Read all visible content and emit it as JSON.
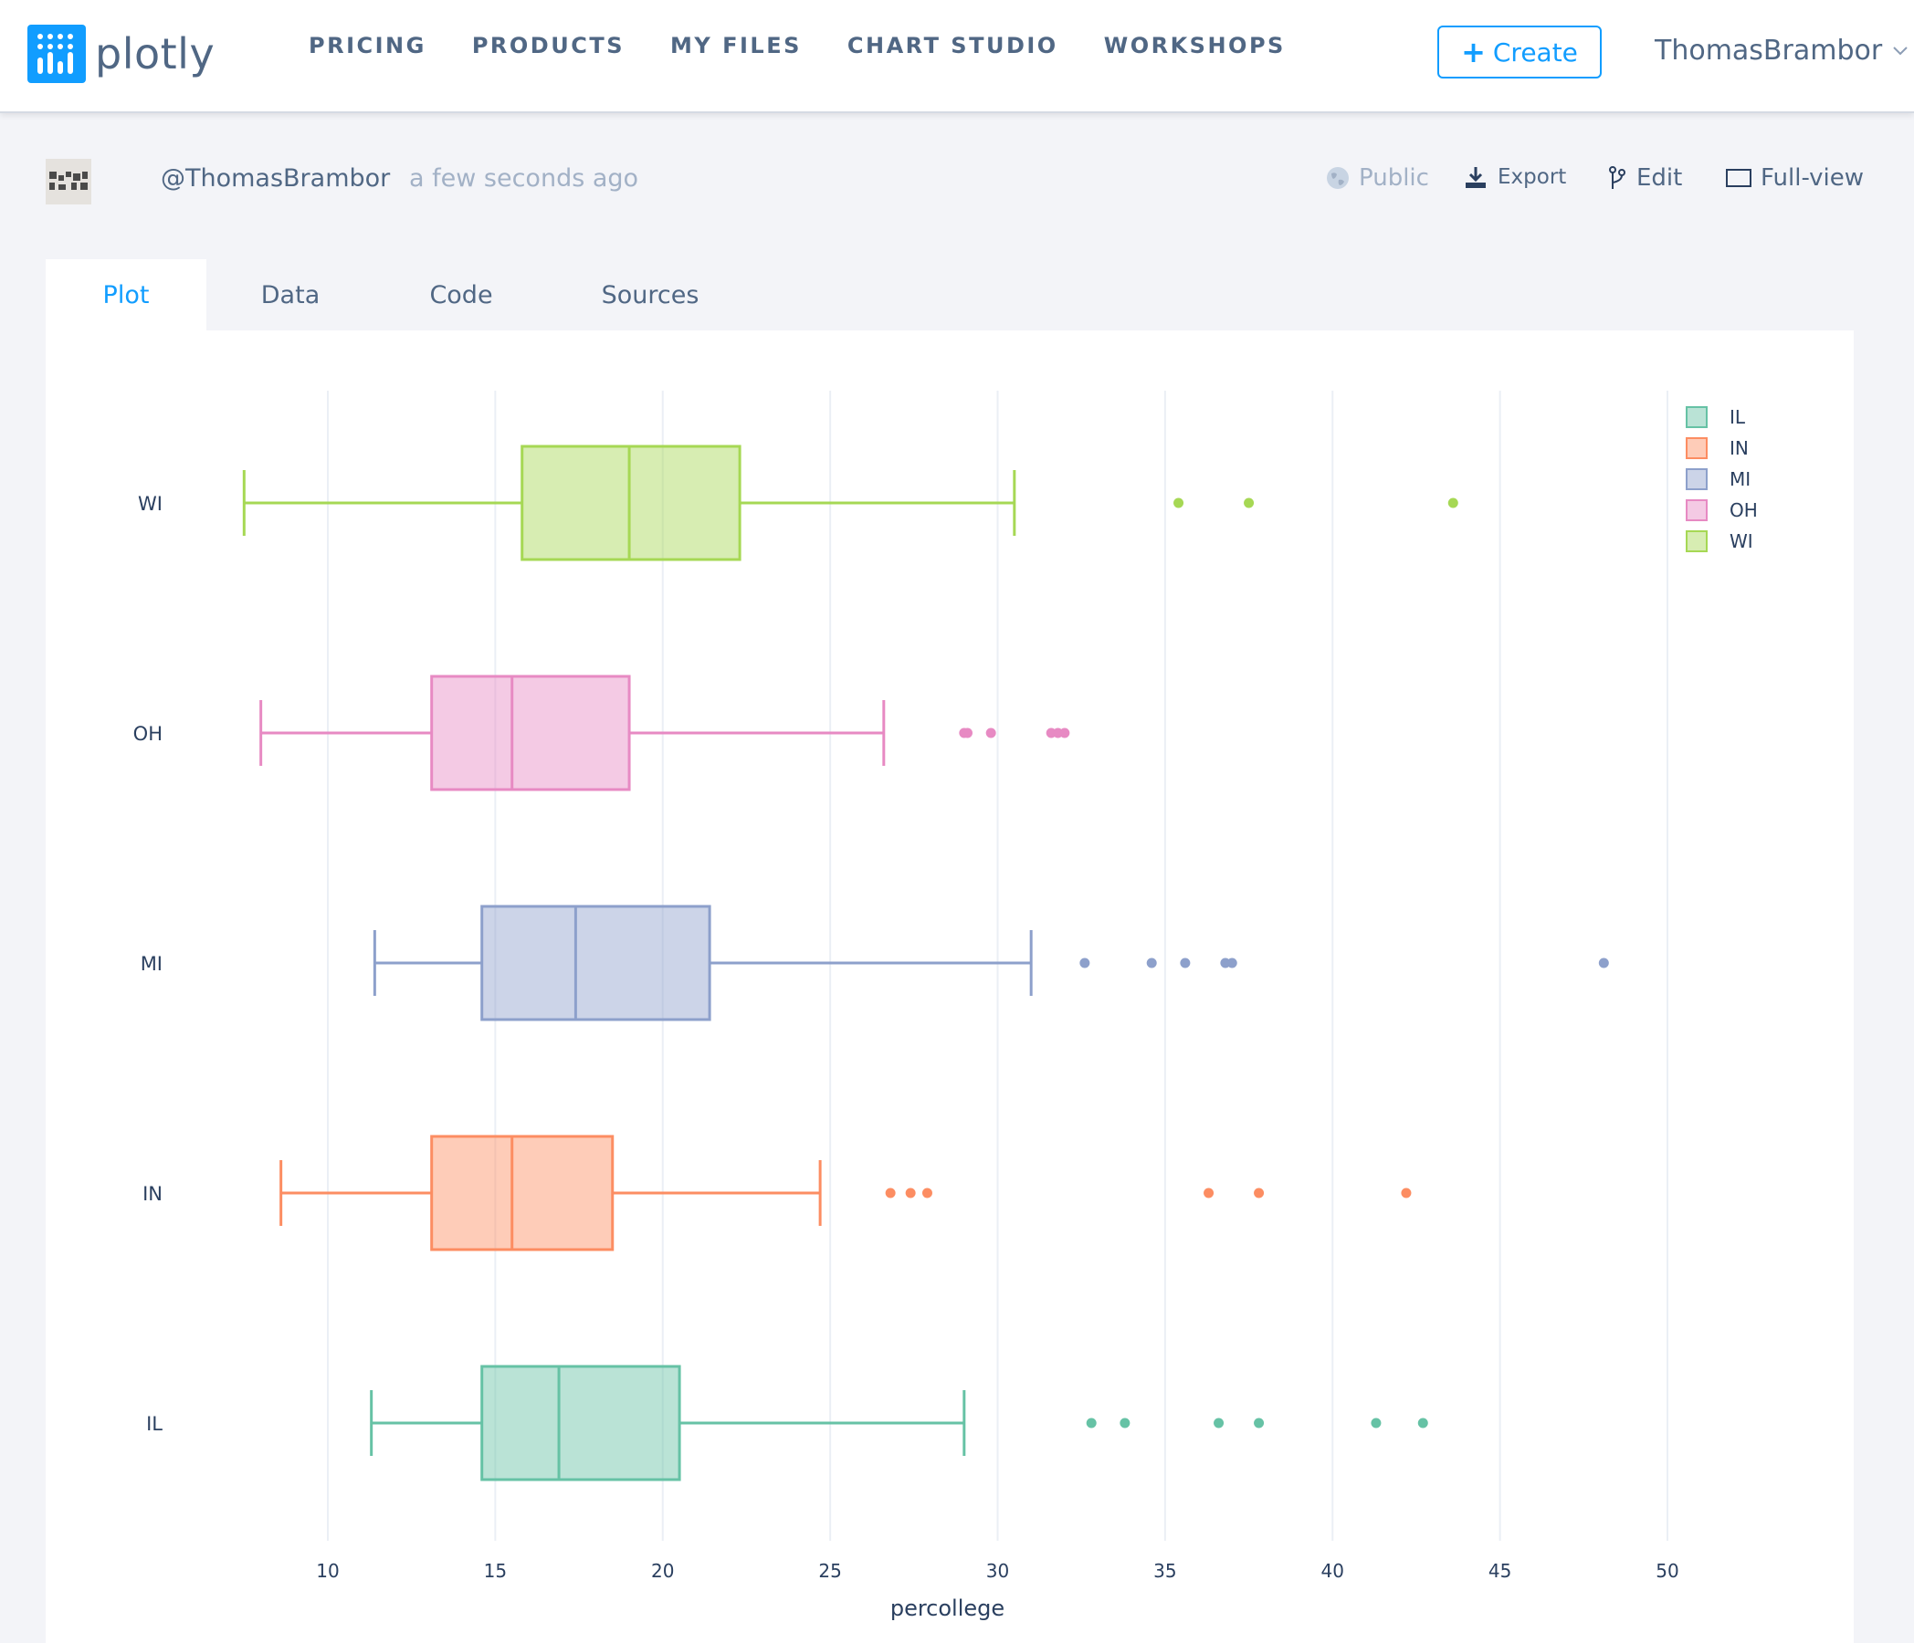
{
  "brand": {
    "name": "plotly",
    "color": "#119dff"
  },
  "nav": {
    "links": [
      "PRICING",
      "PRODUCTS",
      "MY FILES",
      "CHART STUDIO",
      "WORKSHOPS"
    ],
    "create_label": "Create",
    "user": "ThomasBrambor"
  },
  "meta": {
    "owner": "@ThomasBrambor",
    "updated": "a few seconds ago",
    "actions": {
      "public": "Public",
      "export": "Export",
      "edit": "Edit",
      "fullview": "Full-view"
    }
  },
  "tabs": [
    {
      "label": "Plot",
      "active": true
    },
    {
      "label": "Data",
      "active": false
    },
    {
      "label": "Code",
      "active": false
    },
    {
      "label": "Sources",
      "active": false
    }
  ],
  "chart_data": {
    "type": "box",
    "orientation": "horizontal",
    "title": "",
    "xlabel": "percollege",
    "ylabel": "",
    "xlim": [
      7.5,
      51
    ],
    "xticks": [
      10,
      15,
      20,
      25,
      30,
      35,
      40,
      45,
      50
    ],
    "grid": true,
    "legend_position": "top-right",
    "series": [
      {
        "name": "IL",
        "color": "#66c2a5",
        "min": 11.3,
        "q1": 14.6,
        "median": 16.9,
        "q3": 20.5,
        "max": 29.0,
        "outliers": [
          32.8,
          33.8,
          36.6,
          37.8,
          41.3,
          42.7
        ]
      },
      {
        "name": "IN",
        "color": "#fc8d62",
        "min": 8.6,
        "q1": 13.1,
        "median": 15.5,
        "q3": 18.5,
        "max": 24.7,
        "outliers": [
          26.8,
          27.4,
          27.9,
          36.3,
          37.8,
          42.2
        ]
      },
      {
        "name": "MI",
        "color": "#8da0cb",
        "min": 11.4,
        "q1": 14.6,
        "median": 17.4,
        "q3": 21.4,
        "max": 31.0,
        "outliers": [
          32.6,
          34.6,
          35.6,
          36.8,
          37.0,
          48.1
        ]
      },
      {
        "name": "OH",
        "color": "#e78ac3",
        "min": 8.0,
        "q1": 13.1,
        "median": 15.5,
        "q3": 19.0,
        "max": 26.6,
        "outliers": [
          29.0,
          29.1,
          29.8,
          31.6,
          31.8,
          32.0
        ]
      },
      {
        "name": "WI",
        "color": "#a6d854",
        "min": 7.5,
        "q1": 15.8,
        "median": 19.0,
        "q3": 22.3,
        "max": 30.5,
        "outliers": [
          35.4,
          37.5,
          43.6
        ]
      }
    ]
  }
}
